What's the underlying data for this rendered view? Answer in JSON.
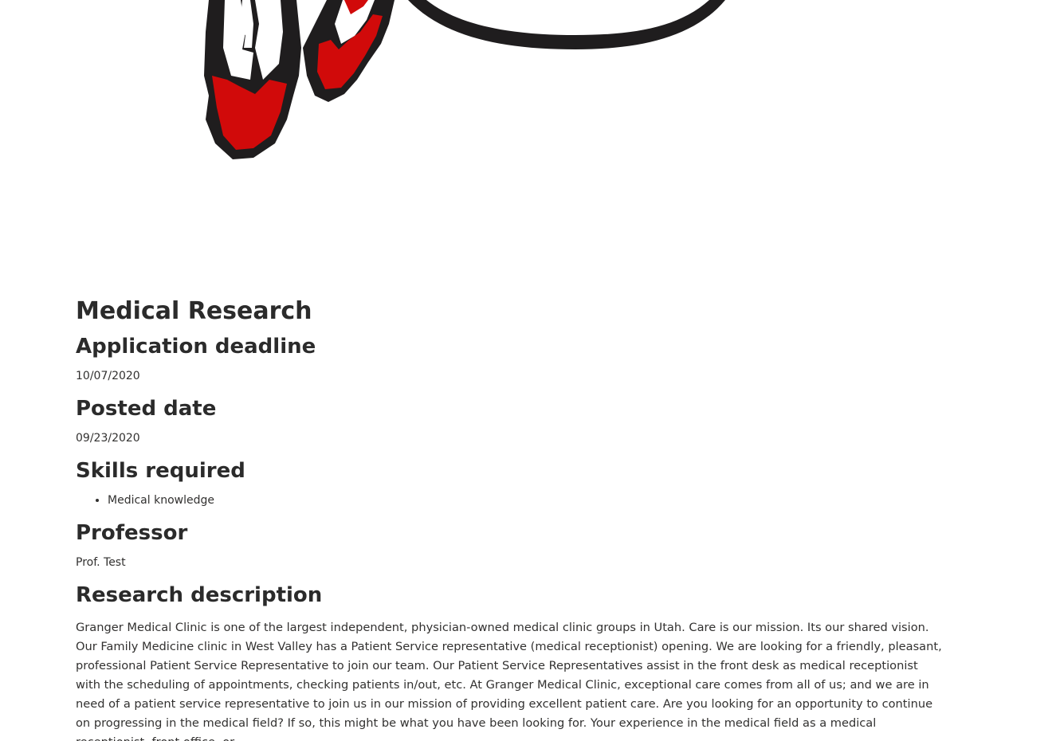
{
  "logo": {
    "icon": "feather-circle-logo-icon",
    "colors": {
      "red": "#d10a0a",
      "black": "#1f1d1e"
    }
  },
  "title": "Medical Research",
  "sections": {
    "deadline": {
      "heading": "Application deadline",
      "value": "10/07/2020"
    },
    "posted": {
      "heading": "Posted date",
      "value": "09/23/2020"
    },
    "skills": {
      "heading": "Skills required",
      "items": [
        "Medical knowledge"
      ]
    },
    "professor": {
      "heading": "Professor",
      "value": "Prof. Test"
    },
    "description": {
      "heading": "Research description",
      "text": "Granger Medical Clinic is one of the largest independent, physician-owned medical clinic groups in Utah. Care is our mission. Its our shared vision. Our Family Medicine clinic in West Valley has a Patient Service representative (medical receptionist) opening. We are looking for a friendly, pleasant, professional Patient Service Representative to join our team. Our Patient Service Representatives assist in the front desk as medical receptionist with the scheduling of appointments, checking patients in/out, etc. At Granger Medical Clinic, exceptional care comes from all of us; and we are in need of a patient service representative to join us in our mission of providing excellent patient care. Are you looking for an opportunity to continue on progressing in the medical field? If so, this might be what you have been looking for. Your experience in the medical field as a medical receptionist, front office, or"
    }
  }
}
